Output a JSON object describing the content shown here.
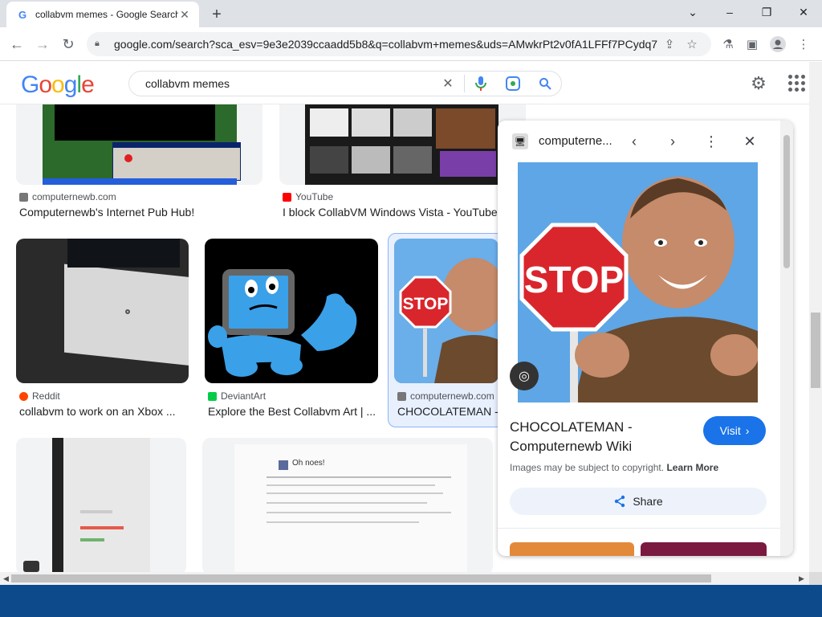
{
  "browser": {
    "tab_title": "collabvm memes - Google Search",
    "tab_favicon": "G",
    "url": "google.com/search?sca_esv=9e3e2039ccaadd5b8&q=collabvm+memes&uds=AMwkrPt2v0fA1LFFf7PCydq7...",
    "icons": [
      "back-icon",
      "forward-icon",
      "reload-icon",
      "lock-icon",
      "share-icon",
      "star-icon",
      "extensions-icon",
      "sidepanel-icon",
      "profile-icon",
      "menu-icon"
    ]
  },
  "google": {
    "logo_letters": [
      "G",
      "o",
      "o",
      "g",
      "l",
      "e"
    ],
    "logo_colors": [
      "#4285f4",
      "#ea4335",
      "#fbbc05",
      "#4285f4",
      "#34a853",
      "#ea4335"
    ],
    "query": "collabvm memes"
  },
  "results": [
    {
      "source": "computernewb.com",
      "caption": "Computernewb's Internet Pub Hub!"
    },
    {
      "source": "YouTube",
      "caption": "I block CollabVM Windows Vista - YouTube"
    },
    {
      "source": "Reddit",
      "caption": "collabvm to work on an Xbox ..."
    },
    {
      "source": "DeviantArt",
      "caption": "Explore the Best Collabvm Art | ..."
    },
    {
      "source": "computernewb.com",
      "caption": "CHOCOLATEMAN - ..."
    }
  ],
  "thumb_text": {
    "stop": "STOP",
    "oh_noes": "Oh noes!"
  },
  "panel": {
    "site": "computerne...",
    "title": "CHOCOLATEMAN - Computernewb Wiki",
    "visit_label": "Visit",
    "copyright": "Images may be subject to copyright.",
    "learn_more": "Learn More",
    "share_label": "Share",
    "stop_sign": "STOP"
  },
  "colors": {
    "accent": "#1a73e8",
    "taskbar": "#0c4a8c",
    "stop_red": "#d9262c"
  }
}
